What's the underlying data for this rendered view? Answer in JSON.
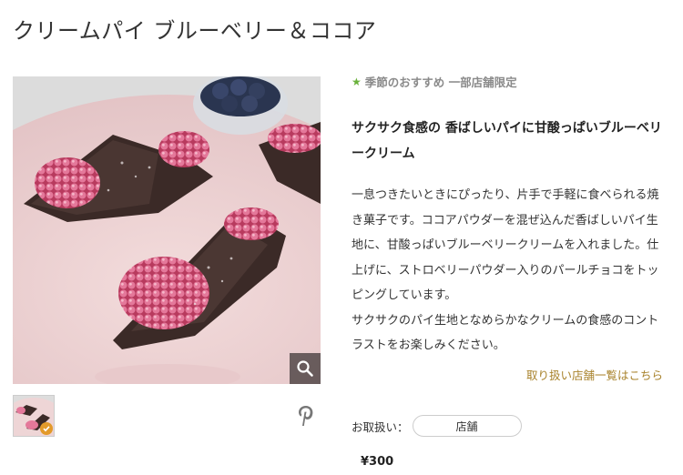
{
  "product": {
    "title": "クリームパイ ブルーベリー＆ココア",
    "tagline": "季節のおすすめ 一部店舗限定",
    "headline": "サクサク食感の 香ばしいパイに甘酸っぱいブルーベリークリーム",
    "description": "一息つきたいときにぴったり、片手で手軽に食べられる焼き菓子です。ココアパウダーを混ぜ込んだ香ばしいパイ生地に、甘酸っぱいブルーベリークリームを入れました。仕上げに、ストロベリーパウダー入りのパールチョコをトッピングしています。\nサクサクのパイ生地となめらかなクリームの食感のコントラストをお楽しみください。",
    "store_link": "取り扱い店舗一覧はこちら",
    "handling_label": "お取扱い：",
    "handling_value": "店舗",
    "price": "¥300"
  },
  "icons": {
    "tag": "star-icon",
    "zoom": "magnifier-icon",
    "share": "pinterest-icon",
    "selected": "check-icon"
  },
  "colors": {
    "accent_green": "#6ab23b",
    "link_gold": "#a8822b"
  }
}
